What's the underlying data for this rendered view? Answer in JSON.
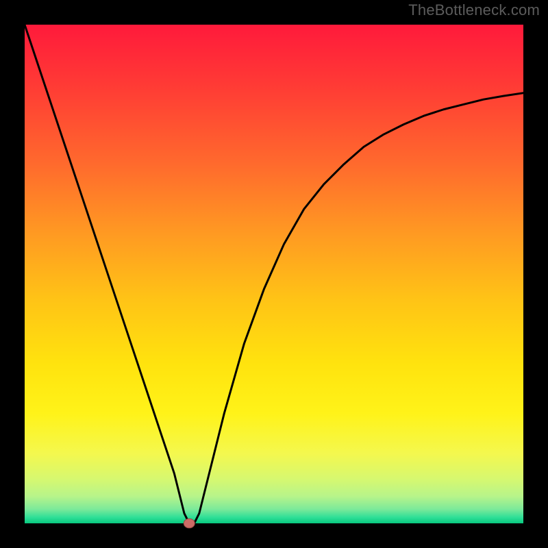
{
  "watermark": "TheBottleneck.com",
  "chart_data": {
    "type": "line",
    "title": "",
    "xlabel": "",
    "ylabel": "",
    "xlim": [
      0,
      100
    ],
    "ylim": [
      0,
      100
    ],
    "grid": false,
    "legend": false,
    "dip_point": {
      "x": 33,
      "y": 0
    },
    "series": [
      {
        "name": "curve",
        "x": [
          0,
          4,
          8,
          12,
          16,
          20,
          24,
          28,
          30,
          31,
          32,
          33,
          34,
          35,
          36,
          38,
          40,
          44,
          48,
          52,
          56,
          60,
          64,
          68,
          72,
          76,
          80,
          84,
          88,
          92,
          96,
          100
        ],
        "y": [
          100,
          88,
          76,
          64,
          52,
          40,
          28,
          16,
          10,
          6,
          2,
          0,
          0,
          2,
          6,
          14,
          22,
          36,
          47,
          56,
          63,
          68,
          72,
          75.5,
          78,
          80,
          81.7,
          83,
          84,
          85,
          85.7,
          86.3
        ]
      }
    ],
    "gradient_stops": [
      {
        "offset": 0.0,
        "color": "#ff1a3b"
      },
      {
        "offset": 0.12,
        "color": "#ff3a35"
      },
      {
        "offset": 0.28,
        "color": "#ff6a2d"
      },
      {
        "offset": 0.42,
        "color": "#ff9a22"
      },
      {
        "offset": 0.55,
        "color": "#ffc316"
      },
      {
        "offset": 0.68,
        "color": "#ffe30e"
      },
      {
        "offset": 0.78,
        "color": "#fff319"
      },
      {
        "offset": 0.86,
        "color": "#f4f84e"
      },
      {
        "offset": 0.91,
        "color": "#d7f86f"
      },
      {
        "offset": 0.946,
        "color": "#b7f48a"
      },
      {
        "offset": 0.972,
        "color": "#7ae99a"
      },
      {
        "offset": 0.988,
        "color": "#2fdf97"
      },
      {
        "offset": 1.0,
        "color": "#08c87f"
      }
    ],
    "frame": {
      "color": "#000000",
      "thickness": 36
    },
    "curve_style": {
      "color": "#000000",
      "thickness": 3
    },
    "dot_style": {
      "fill": "#cc6b66",
      "stroke": "#9c4a44",
      "r": 8
    }
  }
}
